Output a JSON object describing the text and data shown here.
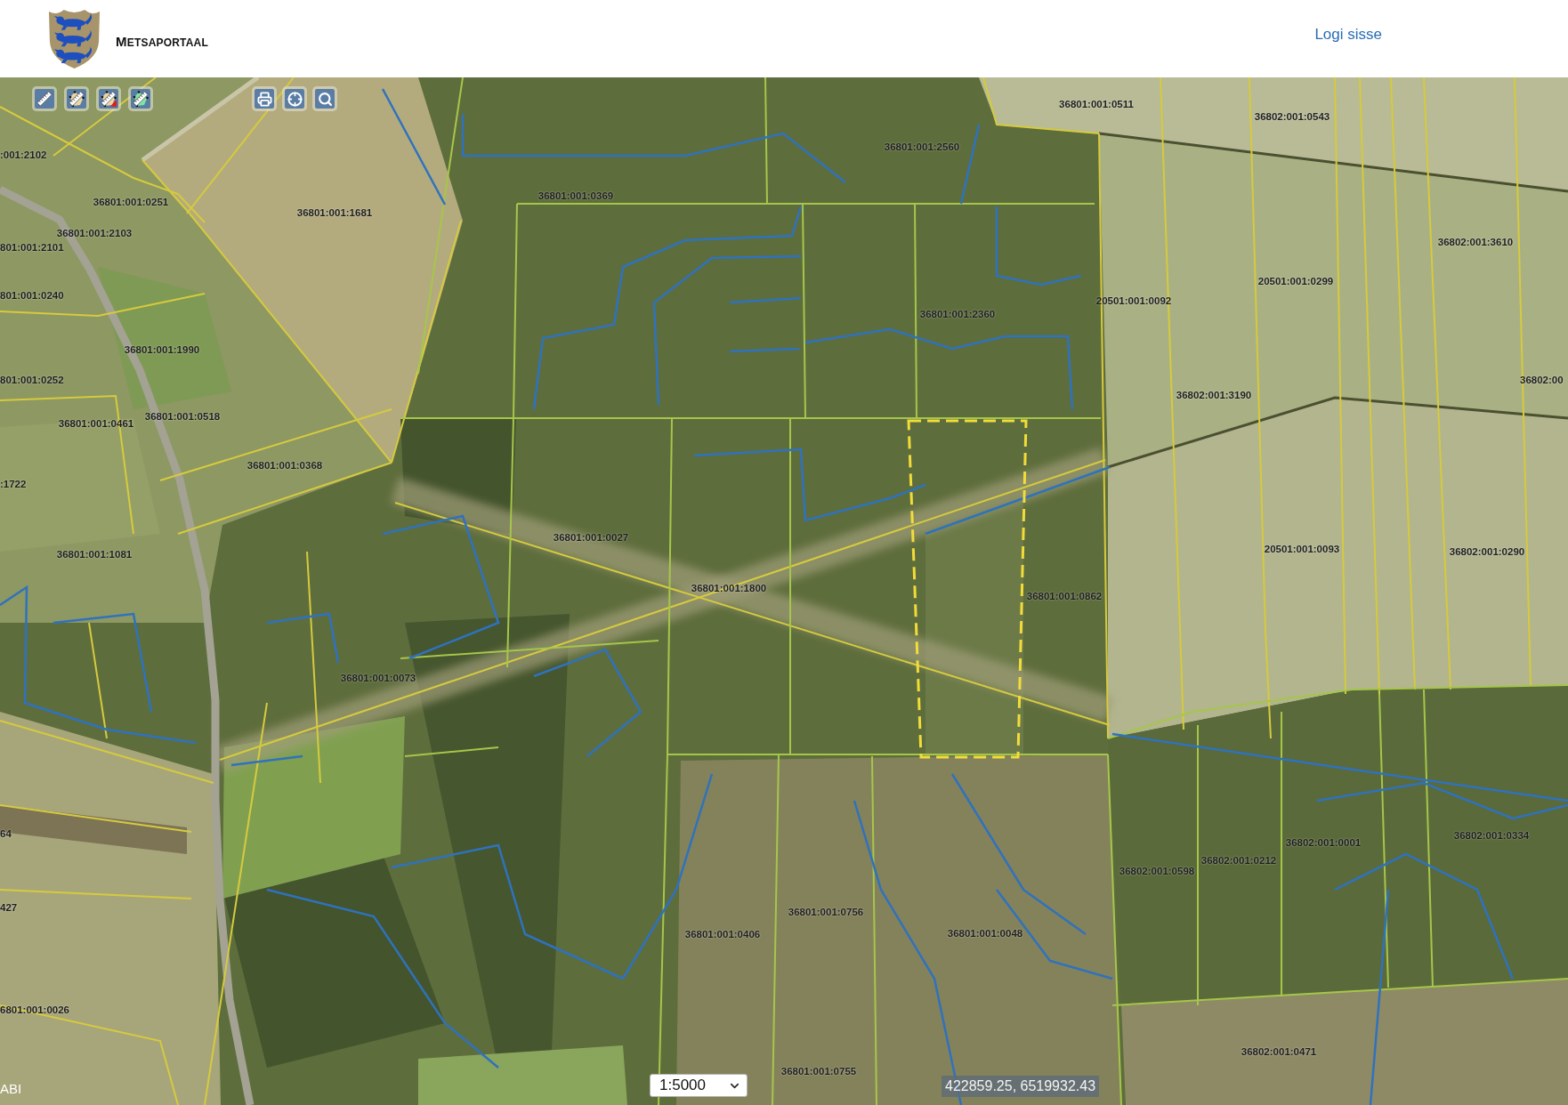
{
  "header": {
    "title": "METSAPORTAAL",
    "login_link": "Logi sisse"
  },
  "map": {
    "parcel_labels": [
      "36801:001:0511",
      "36802:001:0543",
      ":001:2102",
      "36801:001:2560",
      "36801:001:0251",
      "36801:001:0369",
      "36801:001:1681",
      "36801:001:2103",
      "801:001:2101",
      "36802:001:3610",
      "20501:001:0299",
      "801:001:0240",
      "20501:001:0092",
      "36801:001:2360",
      "36801:001:1990",
      "801:001:0252",
      "36802:00",
      "36802:001:3190",
      "36801:001:0461",
      "36801:001:0518",
      "36801:001:0368",
      ":1722",
      "36801:001:0027",
      "36801:001:1081",
      "20501:001:0093",
      "36802:001:0290",
      "36801:001:1800",
      "36801:001:0862",
      "36801:001:0073",
      "64",
      "36802:001:0001",
      "36802:001:0334",
      "36802:001:0598",
      "36802:001:0212",
      "427",
      "36801:001:0756",
      "36801:001:0406",
      "36801:001:0048",
      "6801:001:0026",
      "36802:001:0471",
      "36801:001:0755"
    ],
    "scale": "1:5000",
    "coordinates": "422859.25, 6519932.43",
    "help_link": "ABI"
  }
}
